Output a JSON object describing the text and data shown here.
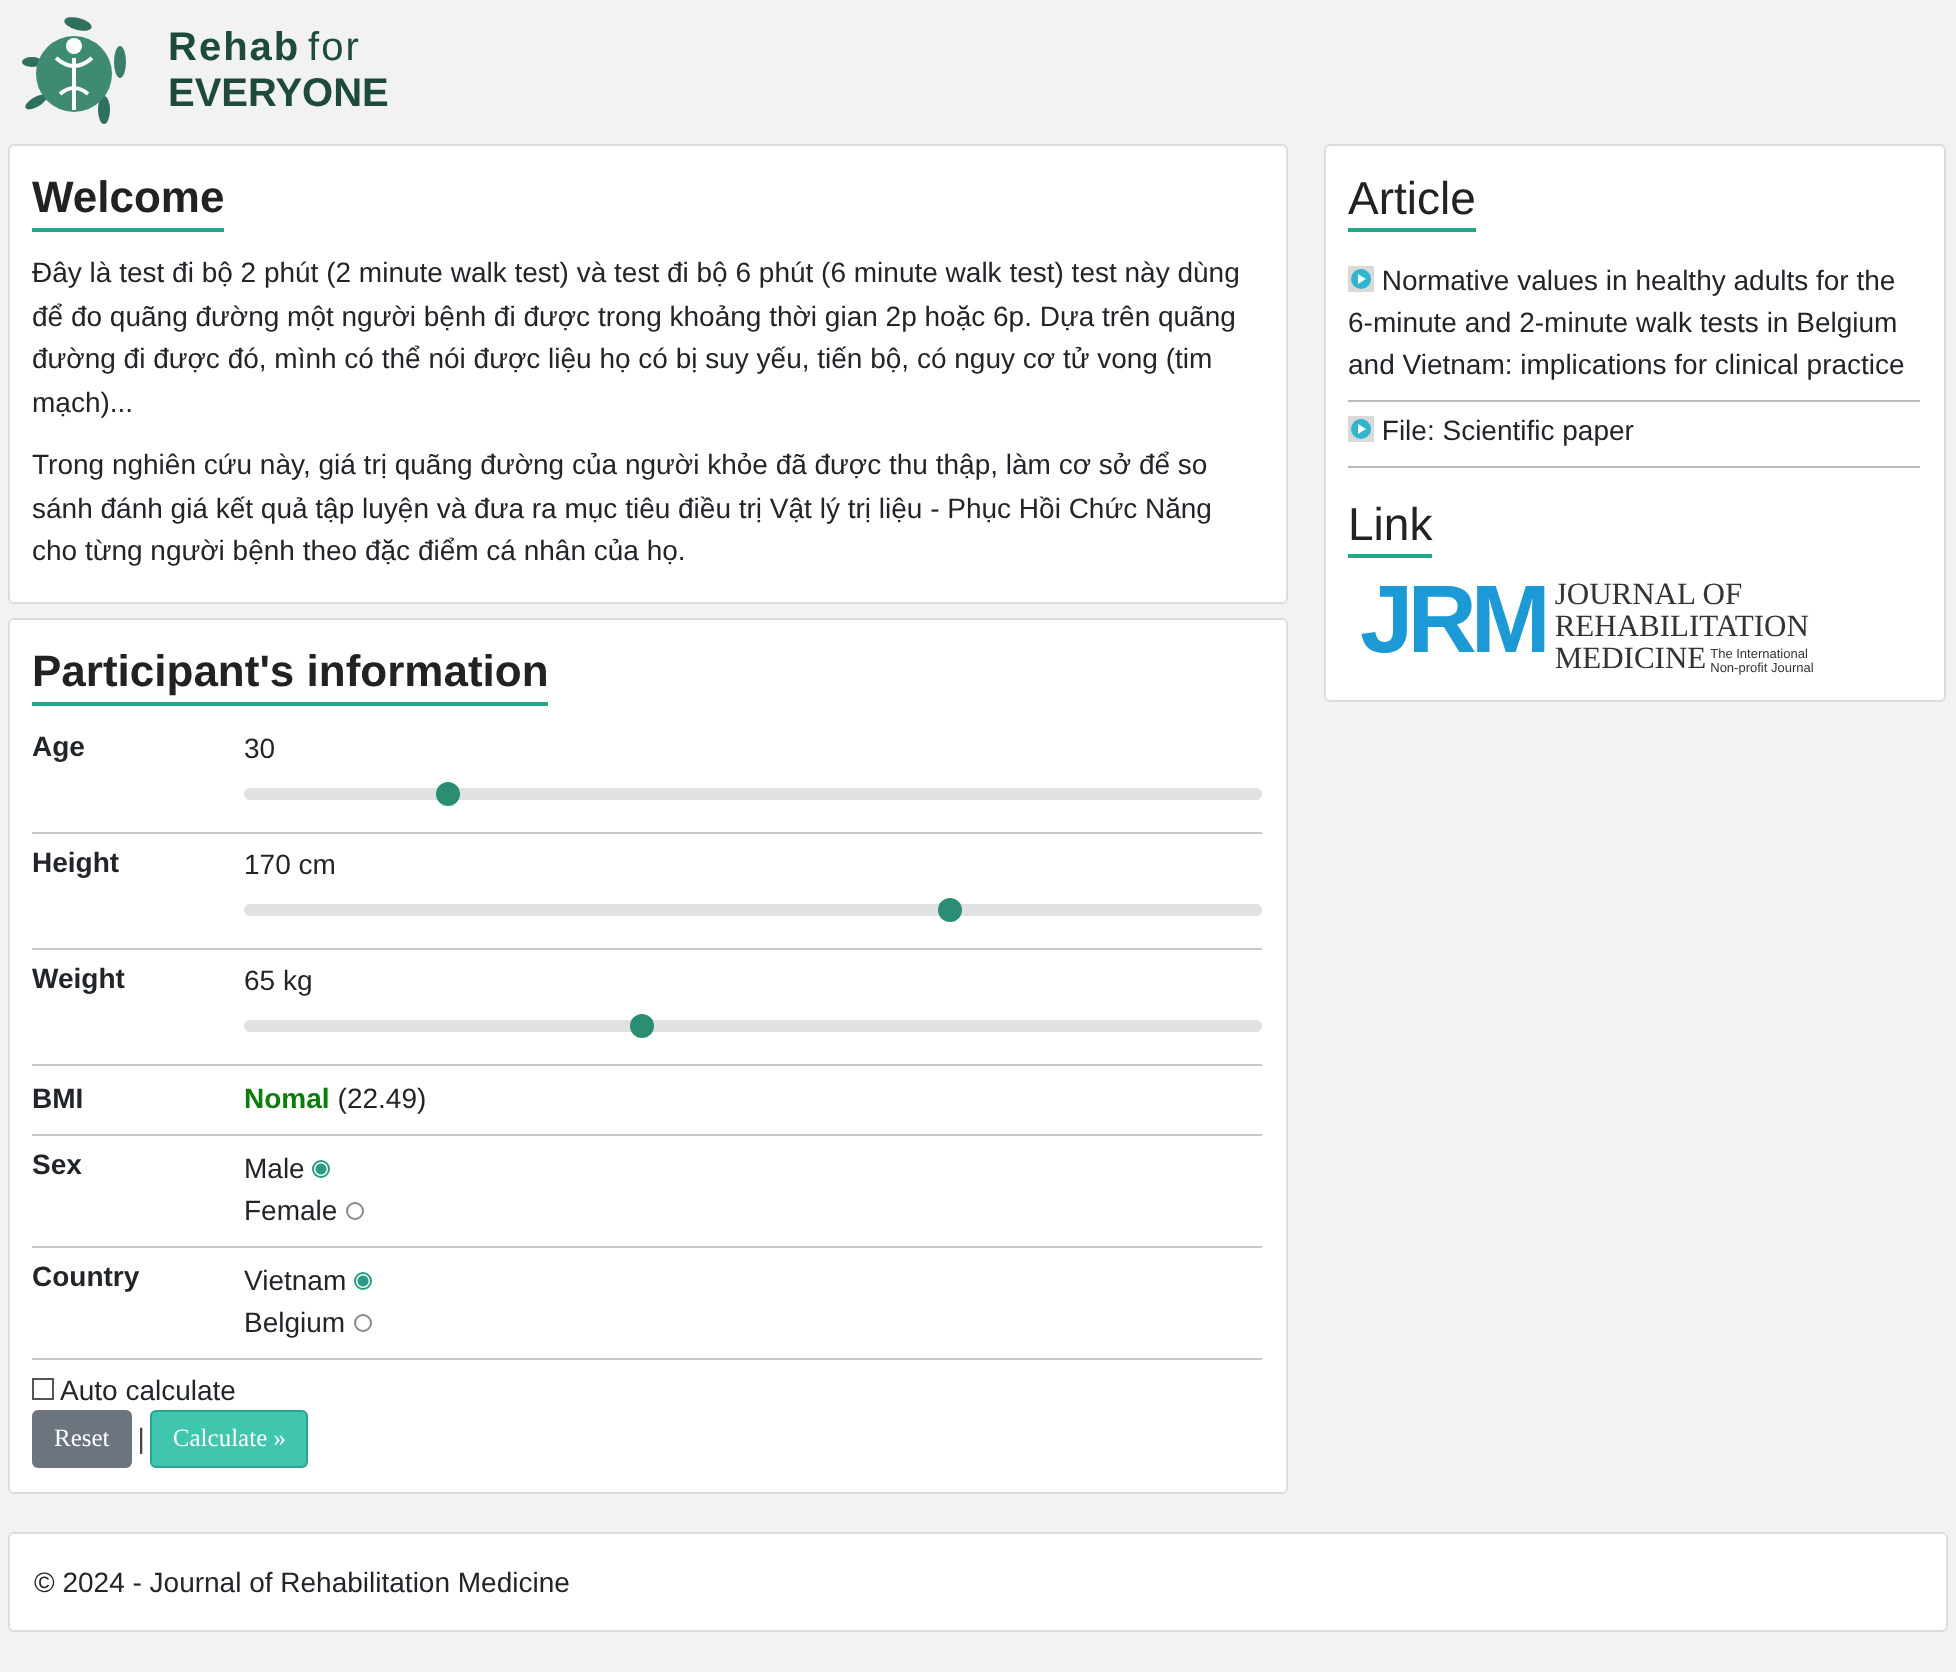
{
  "logo": {
    "line_1": "Rehab",
    "line_1b": "for",
    "line_2": "EVERYONE"
  },
  "welcome": {
    "title": "Welcome",
    "paragraphs": [
      "Đây là test đi bộ 2 phút (2 minute walk test) và test đi bộ 6 phút (6 minute walk test) test này dùng để đo quãng đường một người bệnh đi được trong khoảng thời gian 2p hoặc 6p. Dựa trên quãng đường đi được đó, mình có thể nói được liệu họ có bị suy yếu, tiến bộ, có nguy cơ tử vong (tim mạch)...",
      "Trong nghiên cứu này, giá trị quãng đường của người khỏe đã được thu thập, làm cơ sở để so sánh đánh giá kết quả tập luyện và đưa ra mục tiêu điều trị Vật lý trị liệu - Phục Hồi Chức Năng cho từng người bệnh theo đặc điểm cá nhân của họ."
    ]
  },
  "participant": {
    "title": "Participant's information",
    "rows": [
      {
        "kind": "slider",
        "label": "Age",
        "value": "30",
        "level": 0.2
      },
      {
        "kind": "slider",
        "label": "Height",
        "value": "170 cm",
        "level": 0.694
      },
      {
        "kind": "slider",
        "label": "Weight",
        "value": "65 kg",
        "level": 0.39
      },
      {
        "kind": "bmi",
        "label": "BMI",
        "status": "Nomal",
        "value": "(22.49)"
      },
      {
        "kind": "radio",
        "label": "Sex",
        "options": [
          {
            "label": "Male",
            "selected": true
          },
          {
            "label": "Female",
            "selected": false
          }
        ]
      },
      {
        "kind": "radio",
        "label": "Country",
        "options": [
          {
            "label": "Vietnam",
            "selected": true
          },
          {
            "label": "Belgium",
            "selected": false
          }
        ]
      }
    ],
    "auto_calculate": {
      "label": "Auto calculate",
      "checked": false
    },
    "buttons": {
      "reset": "Reset",
      "separator": "|",
      "calculate": "Calculate »"
    }
  },
  "article": {
    "title": "Article",
    "items": [
      "Normative values in healthy adults for the 6-minute and 2-minute walk tests in Belgium and Vietnam: implications for clinical practice",
      "File: Scientific paper"
    ]
  },
  "link": {
    "title": "Link",
    "logo": {
      "mark": "JRM",
      "lines": [
        "JOURNAL OF",
        "REHABILITATION",
        "MEDICINE"
      ],
      "tagline": [
        "The International",
        "Non-profit Journal"
      ]
    }
  },
  "footer": "© 2024 - Journal of Rehabilitation Medicine"
}
